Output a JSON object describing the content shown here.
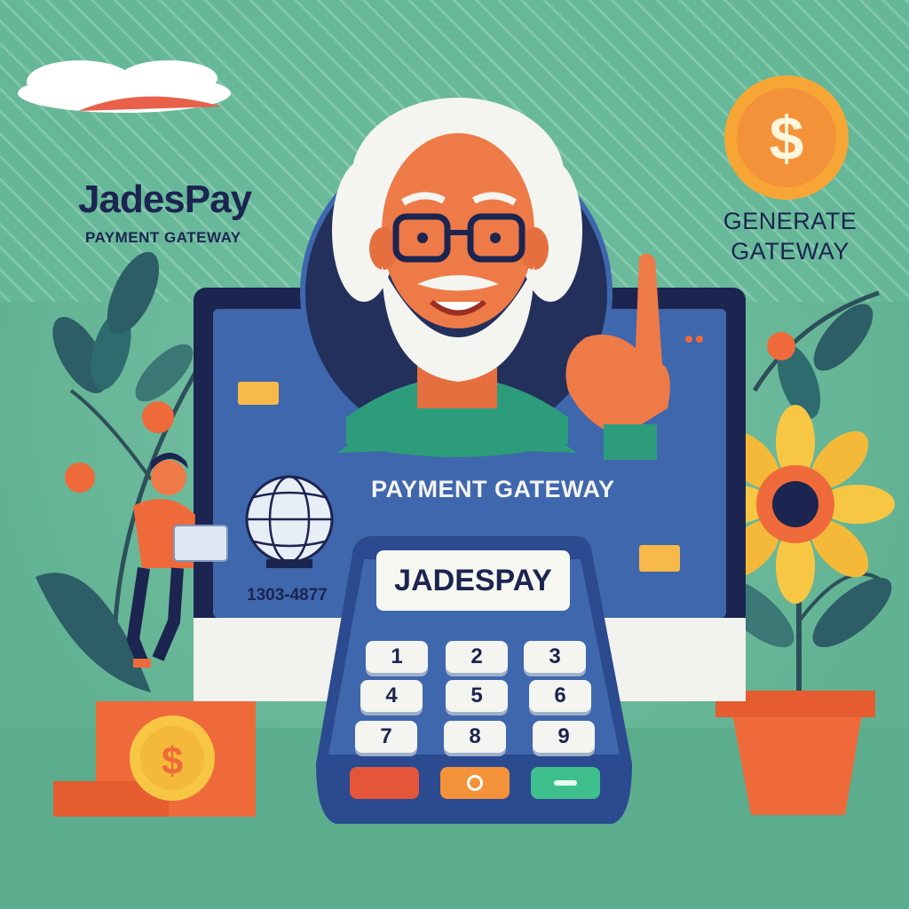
{
  "brand": {
    "name": "JadesPay",
    "subtitle": "PAYMENT GATEWAY"
  },
  "badge": {
    "line1": "GENERATE",
    "line2": "GATEWAY"
  },
  "screen": {
    "title": "PAYMENT GATEWAY",
    "card_number": "1303-4877"
  },
  "terminal": {
    "display": "JADESPAY",
    "keys": [
      "1",
      "2",
      "3",
      "4",
      "5",
      "6",
      "7",
      "8",
      "9"
    ]
  },
  "colors": {
    "background": "#67b99a",
    "monitor": "#3e67ad",
    "navy": "#1c2450",
    "orange": "#ef6a3a",
    "coin": "#f7a635",
    "green_key": "#3fbf8c",
    "red_key": "#e4553a"
  },
  "icons": [
    "dollar-coin-icon",
    "globe-icon",
    "plant-icon",
    "sunflower-icon",
    "person-with-laptop-icon",
    "grandpa-avatar-icon"
  ]
}
